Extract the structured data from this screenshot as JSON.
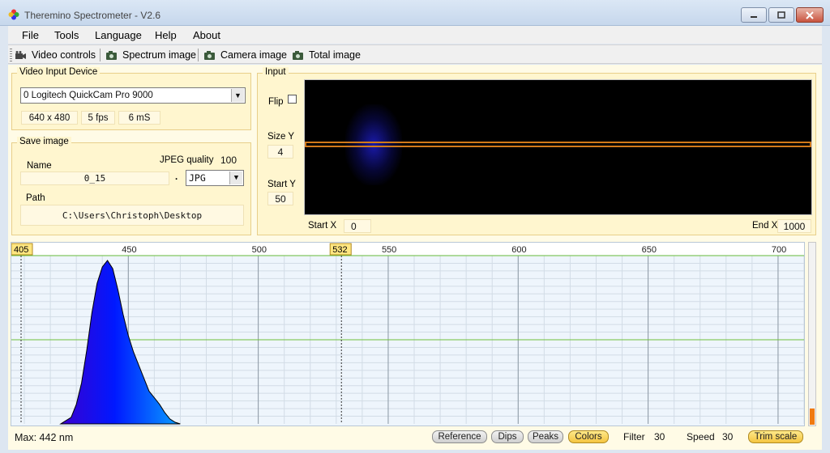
{
  "window": {
    "title": "Theremino Spectrometer - V2.6"
  },
  "menu": [
    "File",
    "Tools",
    "Language",
    "Help",
    "About"
  ],
  "toolbar": {
    "video_controls": "Video controls",
    "spectrum_image": "Spectrum image",
    "camera_image": "Camera image",
    "total_image": "Total image"
  },
  "video_input": {
    "title": "Video Input Device",
    "device": "0 Logitech QuickCam Pro 9000",
    "resolution": "640 x 480",
    "fps": "5 fps",
    "exposure": "6 mS"
  },
  "save_image": {
    "title": "Save image",
    "jpeg_quality_label": "JPEG quality",
    "jpeg_quality": "100",
    "name_label": "Name",
    "name_value": "0_15",
    "dot": ".",
    "format": "JPG",
    "path_label": "Path",
    "path_value": "C:\\Users\\Christoph\\Desktop"
  },
  "input": {
    "title": "Input",
    "flip_label": "Flip",
    "flip_checked": false,
    "size_y_label": "Size Y",
    "size_y": "4",
    "start_y_label": "Start Y",
    "start_y": "50",
    "start_x_label": "Start X",
    "start_x": "0",
    "end_x_label": "End X",
    "end_x": "1000"
  },
  "chart_data": {
    "type": "area",
    "x_range": [
      405,
      710
    ],
    "tick_labels": [
      450,
      500,
      550,
      600,
      650,
      700
    ],
    "markers": [
      405,
      532
    ],
    "x": [
      424,
      428,
      430,
      432,
      434,
      436,
      438,
      440,
      442,
      444,
      446,
      448,
      450,
      452,
      454,
      456,
      458,
      460,
      462,
      464,
      466,
      468,
      470
    ],
    "y": [
      0,
      0.04,
      0.12,
      0.25,
      0.45,
      0.68,
      0.86,
      0.96,
      1.0,
      0.95,
      0.82,
      0.67,
      0.54,
      0.44,
      0.36,
      0.28,
      0.2,
      0.16,
      0.12,
      0.07,
      0.03,
      0.01,
      0
    ],
    "ylim": [
      0,
      1
    ],
    "grid": true
  },
  "spectrum_status": {
    "max_text": "Max: 442 nm",
    "level": 0.09
  },
  "bottom": {
    "reference": "Reference",
    "dips": "Dips",
    "peaks": "Peaks",
    "colors": "Colors",
    "filter_label": "Filter",
    "filter_value": "30",
    "speed_label": "Speed",
    "speed_value": "30",
    "trim_scale": "Trim scale"
  }
}
